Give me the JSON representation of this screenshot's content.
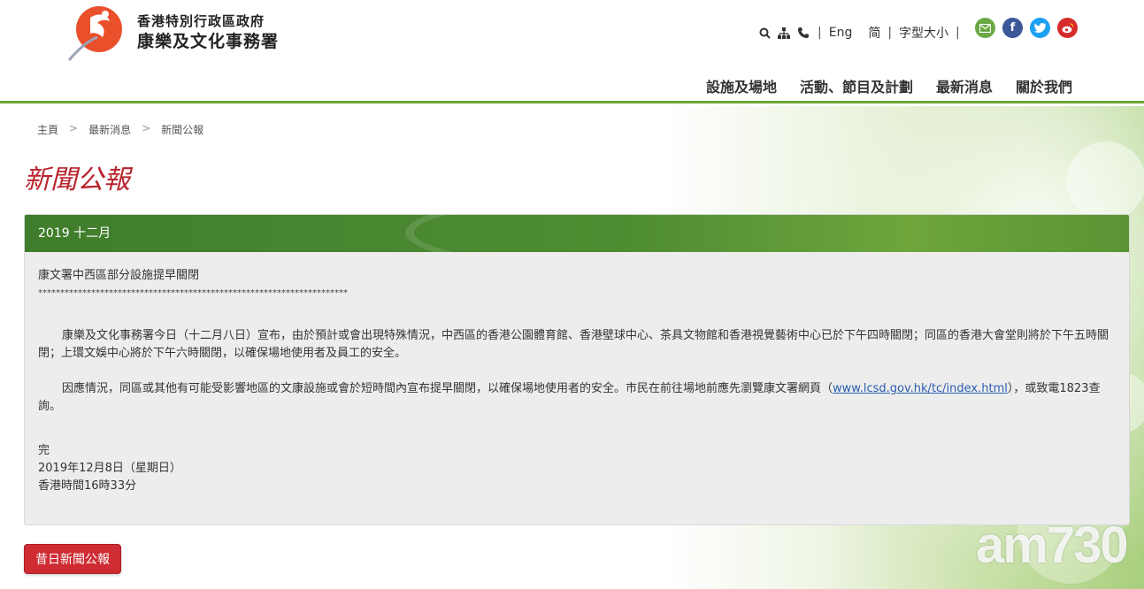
{
  "header": {
    "logo_line1": "香港特別行政區政府",
    "logo_line2": "康樂及文化事務署",
    "util": {
      "eng": "Eng",
      "simplified": "简",
      "font_size": "字型大小",
      "sep": "|"
    },
    "social": [
      {
        "name": "email-icon",
        "glyph": "✉",
        "color": "#6aa843"
      },
      {
        "name": "facebook-icon",
        "glyph": "f",
        "color": "#3b5998"
      },
      {
        "name": "twitter-icon",
        "glyph": "t",
        "color": "#1da1f2"
      },
      {
        "name": "weibo-icon",
        "glyph": "微",
        "color": "#d52b2b"
      }
    ],
    "nav": [
      "設施及場地",
      "活動、節目及計劃",
      "最新消息",
      "關於我們"
    ]
  },
  "breadcrumb": [
    "主頁",
    "最新消息",
    "新聞公報"
  ],
  "breadcrumb_sep": ">",
  "page_title": "新聞公報",
  "panel": {
    "heading": "2019 十二月",
    "news_title": "康文署中西區部分設施提早關閉",
    "stars": "**********************************************************************",
    "para1": "康樂及文化事務署今日（十二月八日）宣布，由於預計或會出現特殊情況，中西區的香港公園體育館、香港壁球中心、茶具文物館和香港視覺藝術中心已於下午四時關閉；同區的香港大會堂則將於下午五時關閉；上環文娛中心將於下午六時關閉，以確保場地使用者及員工的安全。",
    "para2_before": "因應情況，同區或其他有可能受影響地區的文康設施或會於短時間內宣布提早關閉，以確保場地使用者的安全。市民在前往場地前應先瀏覽康文署網頁（",
    "para2_link": "www.lcsd.gov.hk/tc/index.html",
    "para2_after": "），或致電1823查詢。",
    "end": "完",
    "date": "2019年12月8日（星期日）",
    "time": "香港時間16時33分"
  },
  "old_news_button": "昔日新聞公報",
  "watermark": "am730",
  "colors": {
    "accent_green": "#4f8d33",
    "title_red": "#b8232c",
    "button_red": "#cf2b33",
    "link_blue": "#2a5db0"
  }
}
